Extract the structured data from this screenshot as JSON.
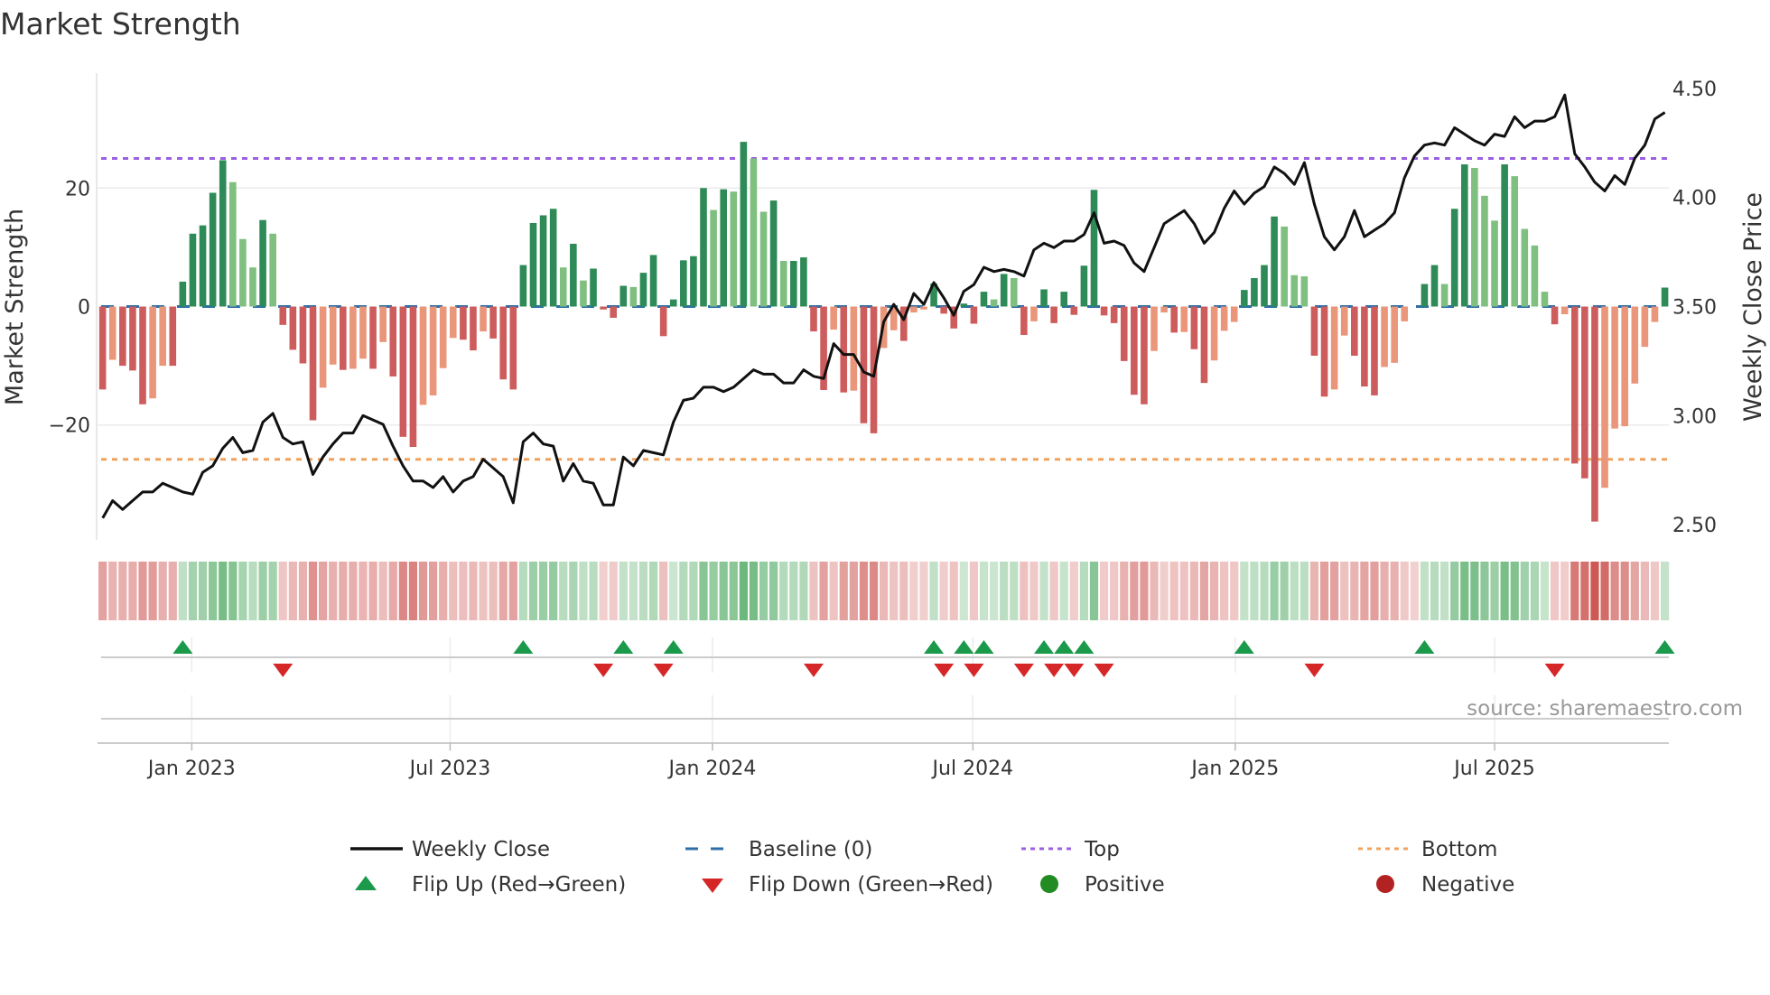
{
  "title": "Market Strength",
  "source": "source: sharemaestro.com",
  "colors": {
    "up_strong": "#2e8b57",
    "up_weak": "#7fbf7f",
    "down_strong": "#cd5c5c",
    "down_weak": "#e9967a",
    "price": "#111111",
    "baseline": "#2c6fa8",
    "top": "#9b5fe0",
    "bottom": "#f0a35e",
    "flip_up": "#1a9a4a",
    "flip_down": "#d62728",
    "positive": "#228b22",
    "negative": "#b22222"
  },
  "legend": {
    "weekly_close": "Weekly Close",
    "baseline": "Baseline (0)",
    "top": "Top",
    "bottom": "Bottom",
    "flip_up": "Flip Up (Red→Green)",
    "flip_down": "Flip Down (Green→Red)",
    "positive": "Positive",
    "negative": "Negative"
  },
  "chart_data": {
    "type": "bar+line",
    "title": "Market Strength",
    "ylabel": "Market Strength",
    "y2label": "Weekly Close Price",
    "ylim": [
      -39.4,
      39.4
    ],
    "y2lim": [
      2.43,
      4.57
    ],
    "xlim": [
      -0.6,
      156.4
    ],
    "yticks": [
      {
        "value": 20,
        "label": "20"
      },
      {
        "value": 0,
        "label": "0"
      },
      {
        "value": -20,
        "label": "−20"
      }
    ],
    "y2ticks": [
      {
        "value": 4.5,
        "label": "4.50"
      },
      {
        "value": 4.0,
        "label": "4.00"
      },
      {
        "value": 3.5,
        "label": "3.50"
      },
      {
        "value": 3.0,
        "label": "3.00"
      },
      {
        "value": 2.5,
        "label": "2.50"
      }
    ],
    "xticks": [
      {
        "week_index": 8.9,
        "label": "Jan 2023"
      },
      {
        "week_index": 34.7,
        "label": "Jul 2023"
      },
      {
        "week_index": 60.9,
        "label": "Jan 2024"
      },
      {
        "week_index": 86.9,
        "label": "Jul 2024"
      },
      {
        "week_index": 113.1,
        "label": "Jan 2025"
      },
      {
        "week_index": 139.0,
        "label": "Jul 2025"
      }
    ],
    "top_level": 25,
    "bottom_level": -25.8,
    "strength": [
      -14,
      -9,
      -10,
      -10.8,
      -16.5,
      -15.5,
      -10,
      -10,
      4.2,
      12.3,
      13.7,
      19.2,
      24.7,
      21,
      11.4,
      6.6,
      14.6,
      12.3,
      -3.1,
      -7.3,
      -9.6,
      -19.2,
      -13.7,
      -9.8,
      -10.7,
      -10.5,
      -8.8,
      -10.5,
      -6,
      -11.8,
      -22,
      -23.7,
      -16.6,
      -15,
      -10.4,
      -5.3,
      -5.6,
      -7.4,
      -4.2,
      -5.4,
      -12.3,
      -14,
      7,
      14.1,
      15.4,
      16.5,
      6.6,
      10.6,
      4.4,
      6.4,
      -0.5,
      -1.9,
      3.5,
      3.3,
      5.7,
      8.7,
      -5,
      1.2,
      7.8,
      8.5,
      20,
      16.3,
      19.8,
      19.4,
      27.8,
      25,
      16,
      17.9,
      7.7,
      7.7,
      8.3,
      -4.2,
      -14.1,
      -3.9,
      -14.5,
      -14.2,
      -19.7,
      -21.4,
      -7,
      -4,
      -5.8,
      -1,
      -0.5,
      3.9,
      -1.2,
      -3.7,
      0.5,
      -2.9,
      2.5,
      1.2,
      5.5,
      4.8,
      -4.8,
      -2.5,
      2.9,
      -2.8,
      2.5,
      -1.4,
      6.9,
      19.7,
      -1.5,
      -2.8,
      -9.2,
      -14.9,
      -16.5,
      -7.5,
      -1,
      -4.4,
      -4.3,
      -7.2,
      -12.9,
      -9.1,
      -4.1,
      -2.6,
      2.8,
      4.8,
      7,
      15.2,
      13.5,
      5.3,
      5.1,
      -8.3,
      -15.2,
      -14,
      -4.9,
      -8.3,
      -13.5,
      -15,
      -10.2,
      -9.5,
      -2.5,
      0,
      3.8,
      7,
      3.8,
      16.5,
      24,
      23.4,
      18.7,
      14.5,
      24,
      22,
      13.1,
      10.3,
      2.5,
      -3,
      -1.3,
      -26.5,
      -29,
      -36.3,
      -30.6,
      -20.6,
      -20.2,
      -13,
      -6.8,
      -2.6,
      3.2
    ],
    "weekly_close": [
      2.53,
      2.61,
      2.57,
      2.61,
      2.65,
      2.65,
      2.69,
      2.67,
      2.65,
      2.64,
      2.74,
      2.77,
      2.85,
      2.9,
      2.83,
      2.84,
      2.97,
      3.01,
      2.9,
      2.87,
      2.88,
      2.73,
      2.81,
      2.87,
      2.92,
      2.92,
      3.0,
      2.98,
      2.96,
      2.86,
      2.77,
      2.7,
      2.7,
      2.67,
      2.72,
      2.65,
      2.7,
      2.72,
      2.8,
      2.76,
      2.72,
      2.6,
      2.88,
      2.92,
      2.87,
      2.86,
      2.7,
      2.78,
      2.7,
      2.69,
      2.59,
      2.59,
      2.81,
      2.77,
      2.84,
      2.83,
      2.82,
      2.97,
      3.07,
      3.08,
      3.13,
      3.13,
      3.11,
      3.13,
      3.17,
      3.21,
      3.19,
      3.19,
      3.15,
      3.15,
      3.21,
      3.18,
      3.17,
      3.33,
      3.28,
      3.28,
      3.2,
      3.18,
      3.43,
      3.51,
      3.44,
      3.56,
      3.51,
      3.61,
      3.54,
      3.46,
      3.57,
      3.6,
      3.68,
      3.66,
      3.67,
      3.66,
      3.64,
      3.76,
      3.79,
      3.77,
      3.8,
      3.8,
      3.83,
      3.93,
      3.79,
      3.8,
      3.78,
      3.7,
      3.66,
      3.77,
      3.88,
      3.91,
      3.94,
      3.88,
      3.79,
      3.84,
      3.95,
      4.03,
      3.97,
      4.02,
      4.05,
      4.14,
      4.11,
      4.06,
      4.16,
      3.97,
      3.82,
      3.76,
      3.82,
      3.94,
      3.82,
      3.85,
      3.88,
      3.93,
      4.09,
      4.19,
      4.24,
      4.25,
      4.24,
      4.32,
      4.29,
      4.26,
      4.24,
      4.29,
      4.28,
      4.37,
      4.32,
      4.35,
      4.35,
      4.37,
      4.47,
      4.2,
      4.14,
      4.07,
      4.03,
      4.1,
      4.06,
      4.18,
      4.24,
      4.36,
      4.39
    ],
    "grid": true,
    "legend_position": "bottom"
  }
}
